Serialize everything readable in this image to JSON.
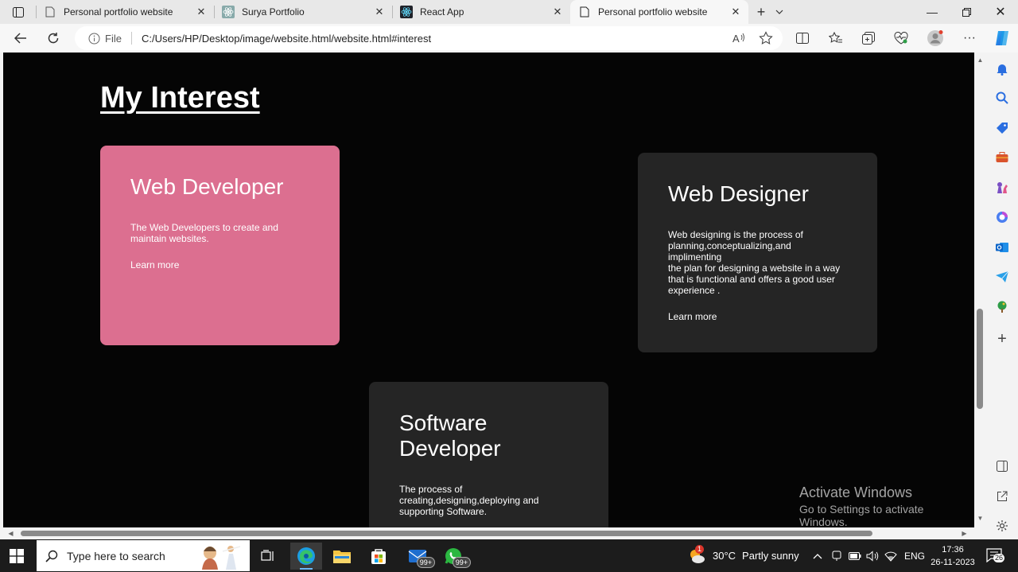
{
  "browser": {
    "tabs": [
      {
        "title": "Personal portfolio website",
        "favicon": "page-icon",
        "active": false
      },
      {
        "title": "Surya Portfolio",
        "favicon": "react-favicon-icon",
        "active": false
      },
      {
        "title": "React App",
        "favicon": "react-favicon-icon",
        "active": false
      },
      {
        "title": "Personal portfolio website",
        "favicon": "page-icon",
        "active": true
      }
    ],
    "address": {
      "scheme_label": "File",
      "url": "C:/Users/HP/Desktop/image/website.html/website.html#interest"
    }
  },
  "page": {
    "heading": "My Interest",
    "cards": [
      {
        "title": "Web Developer",
        "text": "The Web Developers to create and\nmaintain websites.",
        "link": "Learn more",
        "color": "#dc6f90"
      },
      {
        "title": "Web Designer",
        "text": "Web designing is the process of\nplanning,conceptualizing,and\nimplimenting\nthe plan for designing a website in a way\nthat is functional and offers a good user\nexperience .",
        "link": "Learn more",
        "color": "#252525"
      },
      {
        "title": "Software Developer",
        "text": "The process of\ncreating,designing,deploying and\nsupporting Software.",
        "link": "",
        "color": "#252525"
      }
    ],
    "watermark": {
      "line1": "Activate Windows",
      "line2": "Go to Settings to activate Windows."
    }
  },
  "taskbar": {
    "search_placeholder": "Type here to search",
    "mail_badge": "99+",
    "whatsapp_badge": "99+",
    "weather": {
      "temp": "30°C",
      "condition": "Partly sunny",
      "alert": "1"
    },
    "language": "ENG",
    "time": "17:36",
    "date": "26-11-2023",
    "notifications": "26"
  }
}
